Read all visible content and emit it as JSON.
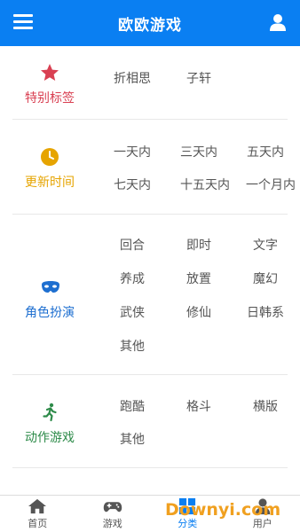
{
  "header": {
    "title": "欧欧游戏",
    "menu_icon": "menu-icon",
    "user_icon": "user-icon"
  },
  "sections": [
    {
      "name": "特别标签",
      "icon": "star-icon",
      "color": "#d94052",
      "tags": [
        "折相思",
        "子轩"
      ]
    },
    {
      "name": "更新时间",
      "icon": "clock-icon",
      "color": "#e6a400",
      "tags": [
        "一天内",
        "三天内",
        "五天内",
        "七天内",
        "十五天内",
        "一个月内"
      ]
    },
    {
      "name": "角色扮演",
      "icon": "mask-icon",
      "color": "#1e6fd0",
      "tags": [
        "回合",
        "即时",
        "文字",
        "养成",
        "放置",
        "魔幻",
        "武侠",
        "修仙",
        "日韩系",
        "其他"
      ]
    },
    {
      "name": "动作游戏",
      "icon": "running-icon",
      "color": "#2e8b4a",
      "tags": [
        "跑酷",
        "格斗",
        "横版",
        "其他"
      ]
    }
  ],
  "tabbar": [
    {
      "label": "首页",
      "icon": "home-icon"
    },
    {
      "label": "游戏",
      "icon": "gamepad-icon"
    },
    {
      "label": "分类",
      "icon": "grid-icon",
      "active": true
    },
    {
      "label": "用户",
      "icon": "user-icon"
    }
  ],
  "watermark": "Downyi.com",
  "colors": {
    "accent": "#0a7ff2",
    "text": "#555555",
    "divider": "#e8e8e8"
  }
}
